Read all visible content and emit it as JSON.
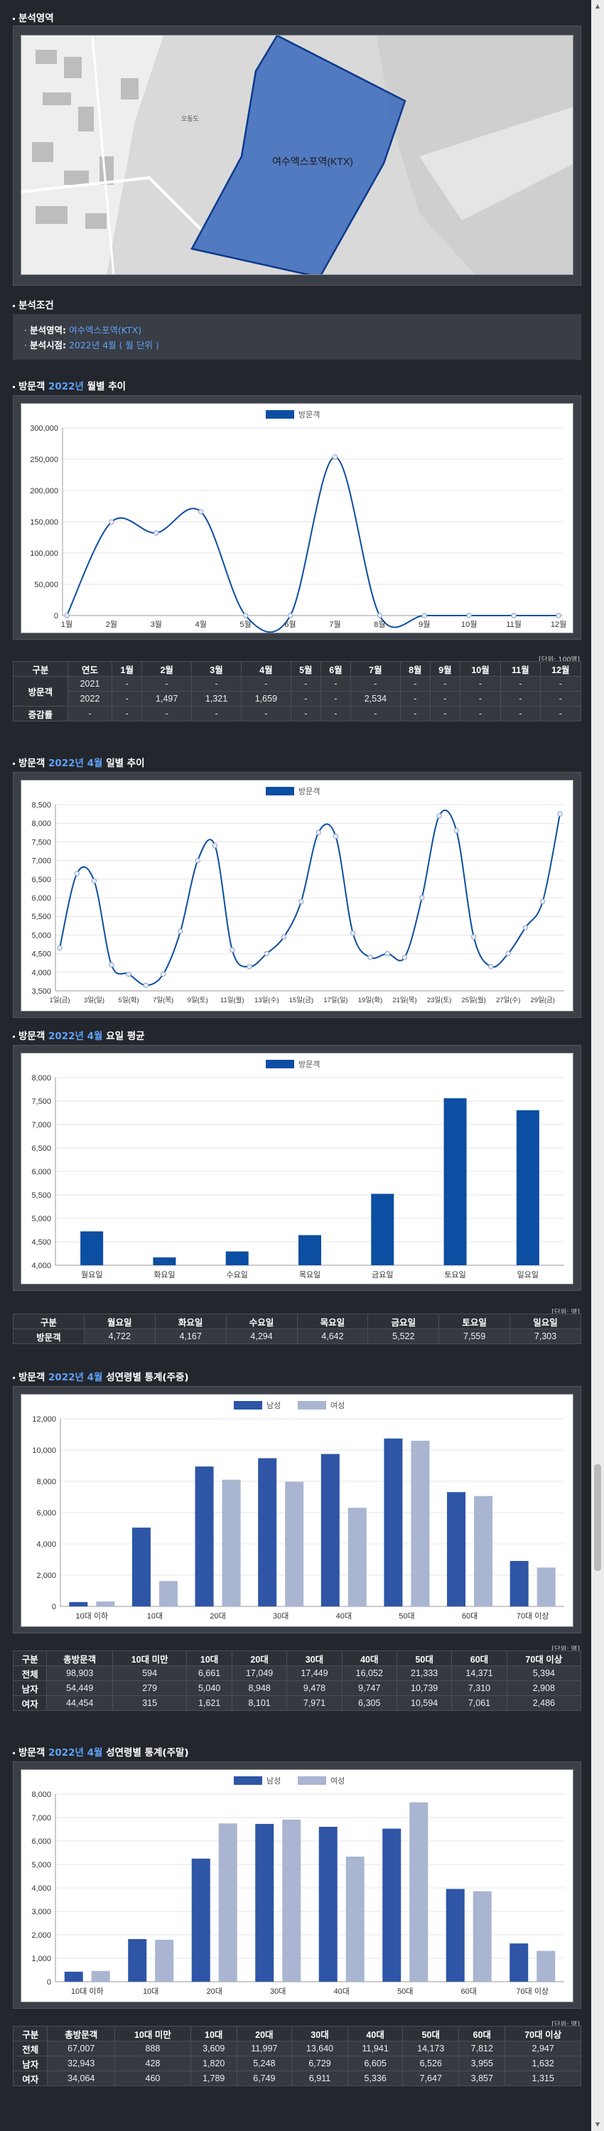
{
  "map_section": {
    "title": "분석영역",
    "area_label": "여수엑스포역(KTX)",
    "map_labels": [
      "오동도"
    ]
  },
  "condition": {
    "title": "분석조건",
    "area_key": "분석영역:",
    "area_value": "여수엑스포역(KTX)",
    "period_key": "분석시점:",
    "period_value": "2022년 4월 ( 월 단위 )"
  },
  "monthly": {
    "title_pre": "방문객",
    "title_year": "2022년",
    "title_post": "월별 추이",
    "unit": "[단위: 100명]",
    "table_headers": [
      "구분",
      "연도",
      "1월",
      "2월",
      "3월",
      "4월",
      "5월",
      "6월",
      "7월",
      "8월",
      "9월",
      "10월",
      "11월",
      "12월"
    ],
    "rows": [
      {
        "group": "방문객",
        "year": "2021",
        "values": [
          "-",
          "-",
          "-",
          "-",
          "-",
          "-",
          "-",
          "-",
          "-",
          "-",
          "-",
          "-"
        ]
      },
      {
        "group": "",
        "year": "2022",
        "values": [
          "-",
          "1,497",
          "1,321",
          "1,659",
          "-",
          "-",
          "2,534",
          "-",
          "-",
          "-",
          "-",
          "-"
        ]
      },
      {
        "group": "증감률",
        "year": "-",
        "values": [
          "-",
          "-",
          "-",
          "-",
          "-",
          "-",
          "-",
          "-",
          "-",
          "-",
          "-",
          "-"
        ]
      }
    ]
  },
  "daily": {
    "title_pre": "방문객",
    "title_year": "2022년 4월",
    "title_post": "일별 추이"
  },
  "weekday": {
    "title_pre": "방문객",
    "title_year": "2022년 4월",
    "title_post": "요일 평균",
    "unit": "[단위: 명]",
    "table_headers": [
      "구분",
      "월요일",
      "화요일",
      "수요일",
      "목요일",
      "금요일",
      "토요일",
      "일요일"
    ],
    "row_label": "방문객",
    "row_values": [
      "4,722",
      "4,167",
      "4,294",
      "4,642",
      "5,522",
      "7,559",
      "7,303"
    ]
  },
  "weekday_gender": {
    "title_pre": "방문객",
    "title_year": "2022년 4월",
    "title_post": "성연령별 통계(주중)",
    "unit": "[단위: 명]",
    "table_headers": [
      "구분",
      "총방문객",
      "10대 미만",
      "10대",
      "20대",
      "30대",
      "40대",
      "50대",
      "60대",
      "70대 이상"
    ],
    "rows": [
      {
        "label": "전체",
        "values": [
          "98,903",
          "594",
          "6,661",
          "17,049",
          "17,449",
          "16,052",
          "21,333",
          "14,371",
          "5,394"
        ]
      },
      {
        "label": "남자",
        "values": [
          "54,449",
          "279",
          "5,040",
          "8,948",
          "9,478",
          "9,747",
          "10,739",
          "7,310",
          "2,908"
        ]
      },
      {
        "label": "여자",
        "values": [
          "44,454",
          "315",
          "1,621",
          "8,101",
          "7,971",
          "6,305",
          "10,594",
          "7,061",
          "2,486"
        ]
      }
    ]
  },
  "weekend_gender": {
    "title_pre": "방문객",
    "title_year": "2022년 4월",
    "title_post": "성연령별 통계(주말)",
    "unit": "[단위: 명]",
    "table_headers": [
      "구분",
      "총방문객",
      "10대 미만",
      "10대",
      "20대",
      "30대",
      "40대",
      "50대",
      "60대",
      "70대 이상"
    ],
    "rows": [
      {
        "label": "전체",
        "values": [
          "67,007",
          "888",
          "3,609",
          "11,997",
          "13,640",
          "11,941",
          "14,173",
          "7,812",
          "2,947"
        ]
      },
      {
        "label": "남자",
        "values": [
          "32,943",
          "428",
          "1,820",
          "5,248",
          "6,729",
          "6,605",
          "6,526",
          "3,955",
          "1,632"
        ]
      },
      {
        "label": "여자",
        "values": [
          "34,064",
          "460",
          "1,789",
          "6,749",
          "6,911",
          "5,336",
          "7,647",
          "3,857",
          "1,315"
        ]
      }
    ]
  },
  "colors": {
    "primary": "#0b4ea2",
    "male": "#2e55a6",
    "female": "#a9b5d1",
    "accent": "#5ea2f5"
  },
  "chart_data": [
    {
      "type": "line",
      "legend": [
        "방문객"
      ],
      "categories": [
        "1월",
        "2월",
        "3월",
        "4월",
        "5월",
        "6월",
        "7월",
        "8월",
        "9월",
        "10월",
        "11월",
        "12월"
      ],
      "series": [
        {
          "name": "방문객",
          "values": [
            0,
            149700,
            132100,
            165900,
            0,
            0,
            253400,
            0,
            0,
            0,
            0,
            0
          ]
        }
      ],
      "ylim": [
        0,
        300000
      ],
      "yticks": [
        "0",
        "50,000",
        "100,000",
        "150,000",
        "200,000",
        "250,000",
        "300,000"
      ]
    },
    {
      "type": "line",
      "legend": [
        "방문객"
      ],
      "x": [
        "1일(금)",
        "2일(토)",
        "3일(일)",
        "4일(월)",
        "5일(화)",
        "6일(수)",
        "7일(목)",
        "8일(금)",
        "9일(토)",
        "10일(일)",
        "11일(월)",
        "12일(화)",
        "13일(수)",
        "14일(목)",
        "15일(금)",
        "16일(토)",
        "17일(일)",
        "18일(월)",
        "19일(화)",
        "20일(수)",
        "21일(목)",
        "22일(금)",
        "23일(토)",
        "24일(일)",
        "25일(월)",
        "26일(화)",
        "27일(수)",
        "28일(목)",
        "29일(금)",
        "30일(토)"
      ],
      "xticks": [
        "1일(금)",
        "3일(일)",
        "5일(화)",
        "7일(목)",
        "9일(토)",
        "11일(월)",
        "13일(수)",
        "15일(금)",
        "17일(일)",
        "19일(화)",
        "21일(목)",
        "23일(토)",
        "25일(월)",
        "27일(수)",
        "29일(금)"
      ],
      "series": [
        {
          "name": "방문객",
          "values": [
            4650,
            6650,
            6450,
            4200,
            3950,
            3650,
            3950,
            5100,
            7000,
            7400,
            4600,
            4150,
            4500,
            4950,
            5900,
            7750,
            7650,
            5050,
            4400,
            4500,
            4400,
            6000,
            8200,
            7800,
            4950,
            4150,
            4500,
            5200,
            5900,
            8250
          ]
        }
      ],
      "ylim": [
        3500,
        8500
      ],
      "yticks": [
        "3,500",
        "4,000",
        "4,500",
        "5,000",
        "5,500",
        "6,000",
        "6,500",
        "7,000",
        "7,500",
        "8,000",
        "8,500"
      ]
    },
    {
      "type": "bar",
      "legend": [
        "방문객"
      ],
      "categories": [
        "월요일",
        "화요일",
        "수요일",
        "목요일",
        "금요일",
        "토요일",
        "일요일"
      ],
      "series": [
        {
          "name": "방문객",
          "values": [
            4722,
            4167,
            4294,
            4642,
            5522,
            7559,
            7303
          ]
        }
      ],
      "ylim": [
        4000,
        8000
      ],
      "yticks": [
        "4,000",
        "4,500",
        "5,000",
        "5,500",
        "6,000",
        "6,500",
        "7,000",
        "7,500",
        "8,000"
      ]
    },
    {
      "type": "bar",
      "legend": [
        "남성",
        "여성"
      ],
      "categories": [
        "10대 이하",
        "10대",
        "20대",
        "30대",
        "40대",
        "50대",
        "60대",
        "70대 이상"
      ],
      "series": [
        {
          "name": "남성",
          "values": [
            279,
            5040,
            8948,
            9478,
            9747,
            10739,
            7310,
            2908
          ]
        },
        {
          "name": "여성",
          "values": [
            315,
            1621,
            8101,
            7971,
            6305,
            10594,
            7061,
            2486
          ]
        }
      ],
      "ylim": [
        0,
        12000
      ],
      "yticks": [
        "0",
        "2,000",
        "4,000",
        "6,000",
        "8,000",
        "10,000",
        "12,000"
      ]
    },
    {
      "type": "bar",
      "legend": [
        "남성",
        "여성"
      ],
      "categories": [
        "10대 이하",
        "10대",
        "20대",
        "30대",
        "40대",
        "50대",
        "60대",
        "70대 이상"
      ],
      "series": [
        {
          "name": "남성",
          "values": [
            428,
            1820,
            5248,
            6729,
            6605,
            6526,
            3955,
            1632
          ]
        },
        {
          "name": "여성",
          "values": [
            460,
            1789,
            6749,
            6911,
            5336,
            7647,
            3857,
            1315
          ]
        }
      ],
      "ylim": [
        0,
        8000
      ],
      "yticks": [
        "0",
        "1,000",
        "2,000",
        "3,000",
        "4,000",
        "5,000",
        "6,000",
        "7,000",
        "8,000"
      ]
    }
  ]
}
